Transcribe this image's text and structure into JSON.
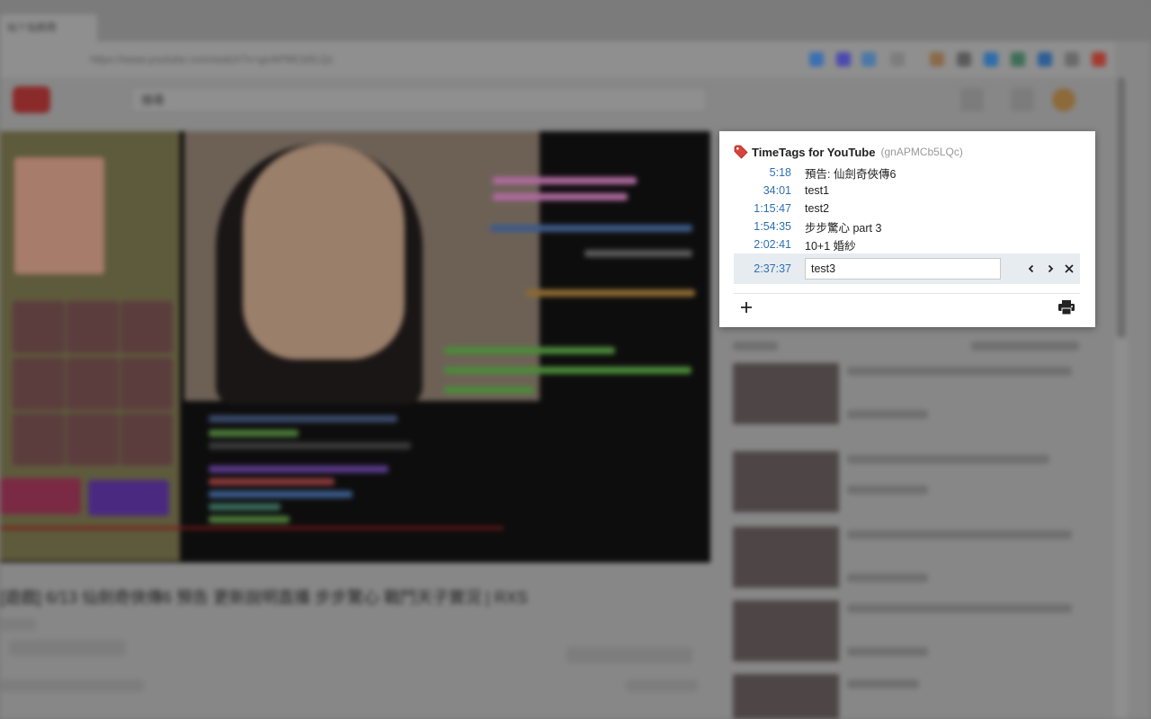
{
  "browser": {
    "tab_title": "仙ㄚ仙劍奇",
    "url": "https://www.youtube.com/watch?v=gnAPMCb5LQc",
    "search_placeholder": "搜尋"
  },
  "video": {
    "title": "[遊戲] 6/13 仙劍奇俠傳6 預告 更新說明直播 步步驚心 戰鬥天子實況 | RXS"
  },
  "popup": {
    "title": "TimeTags for YouTube",
    "video_id": "(gnAPMCb5LQc)",
    "tags": [
      {
        "time": "5:18",
        "label": "預告: 仙劍奇俠傳6"
      },
      {
        "time": "34:01",
        "label": "test1"
      },
      {
        "time": "1:15:47",
        "label": "test2"
      },
      {
        "time": "1:54:35",
        "label": "步步驚心 part 3"
      },
      {
        "time": "2:02:41",
        "label": "10+1 婚紗"
      }
    ],
    "editing": {
      "time": "2:37:37",
      "value": "test3"
    }
  },
  "colors": {
    "timestamp": "#2f6fb0",
    "edit_row_bg": "#e7ecf1",
    "tag_icon": "#d8433a"
  }
}
